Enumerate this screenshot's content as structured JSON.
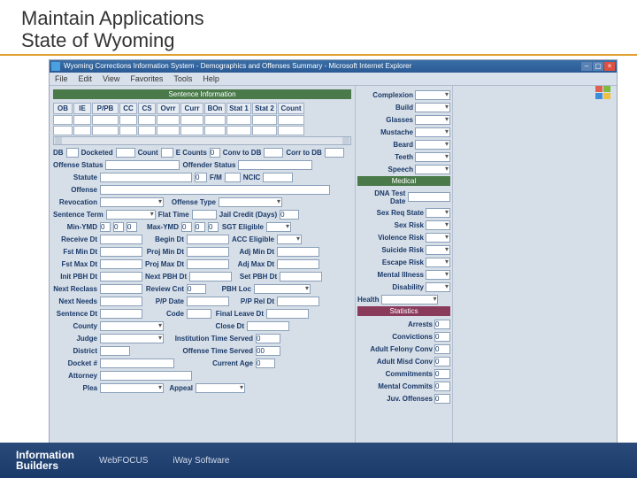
{
  "slide": {
    "title_l1": "Maintain Applications",
    "title_l2": "State of Wyoming"
  },
  "window": {
    "title": "Wyoming Corrections Information System - Demographics and Offenses Summary - Microsoft Internet Explorer"
  },
  "menubar": [
    "File",
    "Edit",
    "View",
    "Favorites",
    "Tools",
    "Help"
  ],
  "main": {
    "section": "Sentence Information",
    "table_headers": [
      "OB",
      "IE",
      "P/PB",
      "CC",
      "CS",
      "Ovrr",
      "Curr",
      "BOn",
      "Stat 1",
      "Stat 2",
      "Count"
    ],
    "row2": {
      "DB": "DB",
      "Docketed": "Docketed",
      "Count": "Count",
      "ECounts": "E Counts",
      "e": "0",
      "ConvToDB": "Conv to DB",
      "CorrToDB": "Corr to DB"
    },
    "offenseStatus": "Offense Status",
    "offenderStatus": "Offender Status",
    "statute": "Statute",
    "fm": "F/M",
    "ncic": "NCIC",
    "offense": "Offense",
    "revocation": "Revocation",
    "offenseType": "Offense Type",
    "sentenceTerm": "Sentence Term",
    "flatTime": "Flat Time",
    "jailCredit": "Jail Credit (Days)",
    "jc": "0",
    "minYMD": "Min-YMD",
    "maxYMD": "Max-YMD",
    "sgtEligible": "SGT Eligible",
    "receiveDt": "Receive Dt",
    "beginDt": "Begin Dt",
    "accEligible": "ACC Eligible",
    "fstMinDt": "Fst Min Dt",
    "projMinDt": "Proj Min Dt",
    "adjMinDt": "Adj Min Dt",
    "fstMaxDt": "Fst Max Dt",
    "projMaxDt": "Proj Max Dt",
    "adjMaxDt": "Adj Max Dt",
    "initPBHDt": "Init PBH Dt",
    "nextPBHDt": "Next PBH Dt",
    "setPBHDt": "Set PBH Dt",
    "nextReclass": "Next Reclass",
    "reviewCnt": "Review Cnt",
    "rc": "0",
    "pbhLoc": "PBH Loc",
    "nextNeeds": "Next Needs",
    "ppDate": "P/P Date",
    "ppRelDt": "P/P Rel Dt",
    "sentenceDt": "Sentence Dt",
    "code": "Code",
    "finalLeaveDt": "Final Leave Dt",
    "county": "County",
    "closeDt": "Close Dt",
    "judge": "Judge",
    "institutionTimeServed": "Institution Time Served",
    "its": "0",
    "district": "District",
    "offenseTimeServed": "Offense Time Served",
    "ots": "00",
    "docketN": "Docket #",
    "currentAge": "Current Age",
    "ca": "0",
    "attorney": "Attorney",
    "plea": "Plea",
    "appeal": "Appeal"
  },
  "right": {
    "complexion": "Complexion",
    "build": "Build",
    "glasses": "Glasses",
    "mustache": "Mustache",
    "beard": "Beard",
    "teeth": "Teeth",
    "speech": "Speech",
    "medicalHdr": "Medical",
    "dnaTestDate": "DNA Test Date",
    "sexReqState": "Sex Req State",
    "sexRisk": "Sex Risk",
    "violenceRisk": "Violence Risk",
    "suicideRisk": "Suicide Risk",
    "escapeRisk": "Escape Risk",
    "mentalIllness": "Mental Illness",
    "disability": "Disability",
    "health": "Health",
    "statsHdr": "Statistics",
    "arrests": "Arrests",
    "ar": "0",
    "convictions": "Convictions",
    "cv": "0",
    "adultFelonyConv": "Adult Felony Conv",
    "afc": "0",
    "adultMisdConv": "Adult Misd Conv",
    "amc": "0",
    "commitments": "Commitments",
    "cm": "0",
    "mentalCommits": "Mental Commits",
    "mc": "0",
    "juvOffenses": "Juv. Offenses",
    "jo": "0"
  },
  "footer": {
    "ib1": "Information",
    "ib2": "Builders",
    "wf": "WebFOCUS",
    "iw": "iWay Software"
  }
}
